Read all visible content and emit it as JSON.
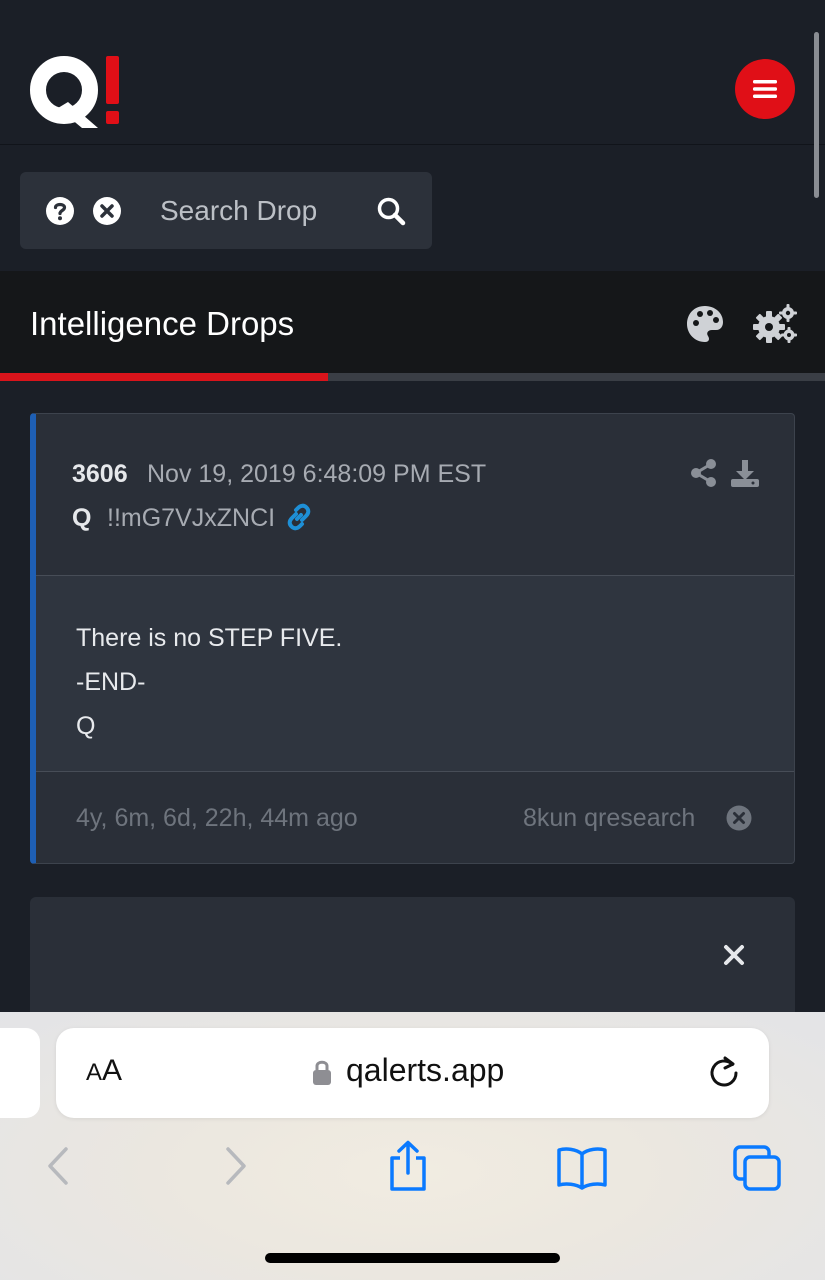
{
  "header": {
    "logo_alt": "Q!",
    "menu_icon": "hamburger-menu-icon"
  },
  "search": {
    "placeholder": "Search Drop",
    "help_icon": "question-icon",
    "clear_icon": "close-icon",
    "search_icon": "search-icon"
  },
  "title_bar": {
    "title": "Intelligence Drops",
    "theme_icon": "palette-icon",
    "settings_icon": "gears-icon",
    "progress_fraction": 0.397
  },
  "drop": {
    "number": "3606",
    "date": "Nov 19, 2019 6:48:09 PM EST",
    "author": "Q",
    "tripcode": "!!mG7VJxZNCI",
    "body_lines": [
      "There is no STEP FIVE.",
      "-END-",
      "Q"
    ],
    "age": "4y, 6m, 6d, 22h, 44m ago",
    "source": "8kun qresearch"
  },
  "browser": {
    "text_size_label": "AA",
    "url": "qalerts.app"
  },
  "colors": {
    "accent_red": "#e00f17",
    "card_border_blue": "#1e5fb4",
    "link_blue": "#1e8fd6",
    "ios_blue": "#0a7aff"
  }
}
